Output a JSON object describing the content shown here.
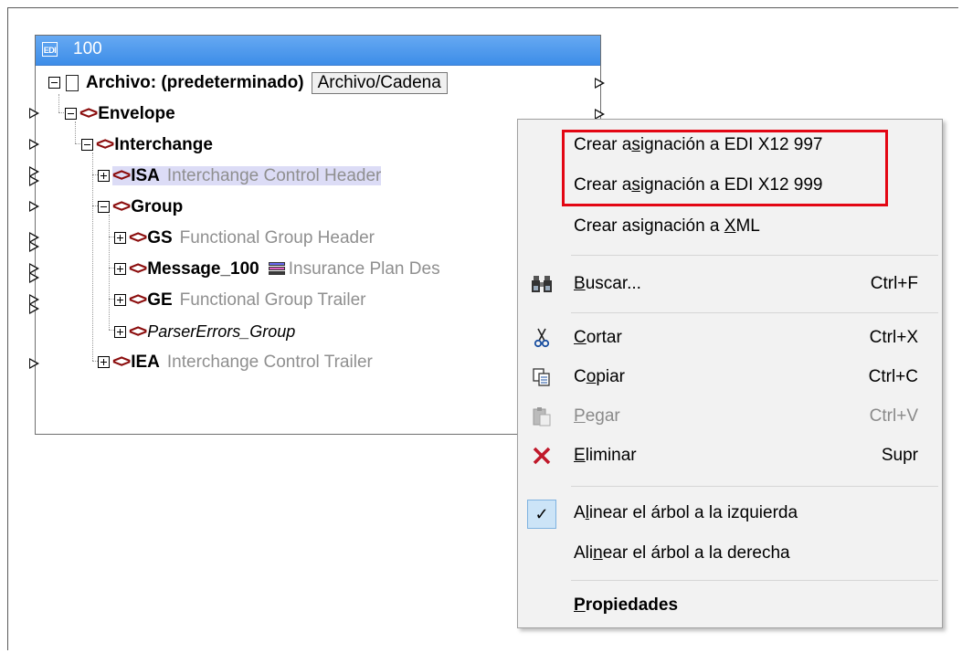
{
  "component": {
    "title": "100",
    "edi_badge": "EDI",
    "file_label": "Archivo: (predeterminado)",
    "file_button": "Archivo/Cadena",
    "tree": [
      {
        "name": "Envelope",
        "desc": ""
      },
      {
        "name": "Interchange",
        "desc": ""
      },
      {
        "name": "ISA",
        "desc": "Interchange Control Header"
      },
      {
        "name": "Group",
        "desc": ""
      },
      {
        "name": "GS",
        "desc": "Functional Group Header"
      },
      {
        "name": "Message_100",
        "desc": "Insurance Plan Des"
      },
      {
        "name": "GE",
        "desc": "Functional Group Trailer"
      },
      {
        "name": "ParserErrors_Group",
        "desc": ""
      },
      {
        "name": "IEA",
        "desc": "Interchange Control Trailer"
      }
    ]
  },
  "menu": {
    "items": [
      {
        "pre": "Crear a",
        "u": "s",
        "post": "ignación a EDI X12 997",
        "shortcut": ""
      },
      {
        "pre": "Crear a",
        "u": "s",
        "post": "ignación a EDI X12 999",
        "shortcut": ""
      },
      {
        "pre": "Crear asignación a ",
        "u": "X",
        "post": "ML",
        "shortcut": ""
      },
      {
        "pre": "",
        "u": "B",
        "post": "uscar...",
        "shortcut": "Ctrl+F",
        "icon": "binoculars-icon"
      },
      {
        "pre": "",
        "u": "C",
        "post": "ortar",
        "shortcut": "Ctrl+X",
        "icon": "scissors-icon"
      },
      {
        "pre": "C",
        "u": "o",
        "post": "piar",
        "shortcut": "Ctrl+C",
        "icon": "copy-icon"
      },
      {
        "pre": "",
        "u": "P",
        "post": "egar",
        "shortcut": "Ctrl+V",
        "icon": "paste-icon",
        "disabled": true
      },
      {
        "pre": "",
        "u": "E",
        "post": "liminar",
        "shortcut": "Supr",
        "icon": "delete-icon"
      },
      {
        "pre": "A",
        "u": "l",
        "post": "inear el árbol a la izquierda",
        "shortcut": "",
        "checked": true
      },
      {
        "pre": "Ali",
        "u": "n",
        "post": "ear el árbol a la derecha",
        "shortcut": ""
      },
      {
        "pre": "",
        "u": "P",
        "post": "ropiedades",
        "shortcut": "",
        "bold": true
      }
    ]
  },
  "colors": {
    "titlebar": "#4a97ec",
    "highlight": "#e30613",
    "element_icon": "#8b0d0d"
  }
}
